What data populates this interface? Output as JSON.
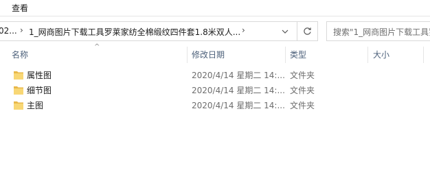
{
  "ribbon": {
    "view_tab": "查看"
  },
  "address": {
    "crumb_prev": "02...",
    "crumb_current": "1_网商图片下载工具罗莱家纺全棉缎纹四件套1.8米双人..."
  },
  "search": {
    "placeholder": "搜索\"1_网商图片下载工具罗"
  },
  "columns": {
    "name": "名称",
    "modified": "修改日期",
    "type": "类型",
    "size": "大小"
  },
  "files": [
    {
      "name": "属性图",
      "modified": "2020/4/14 星期二 14:...",
      "type": "文件夹",
      "size": ""
    },
    {
      "name": "细节图",
      "modified": "2020/4/14 星期二 14:...",
      "type": "文件夹",
      "size": ""
    },
    {
      "name": "主图",
      "modified": "2020/4/14 星期二 14:...",
      "type": "文件夹",
      "size": ""
    }
  ],
  "colors": {
    "folder": "#f8d775",
    "folder_dark": "#e8b84a",
    "header_text": "#4c607a"
  },
  "icons": [
    "chevron-right-icon",
    "chevron-down-icon",
    "refresh-icon",
    "sort-up-icon",
    "folder-icon"
  ]
}
